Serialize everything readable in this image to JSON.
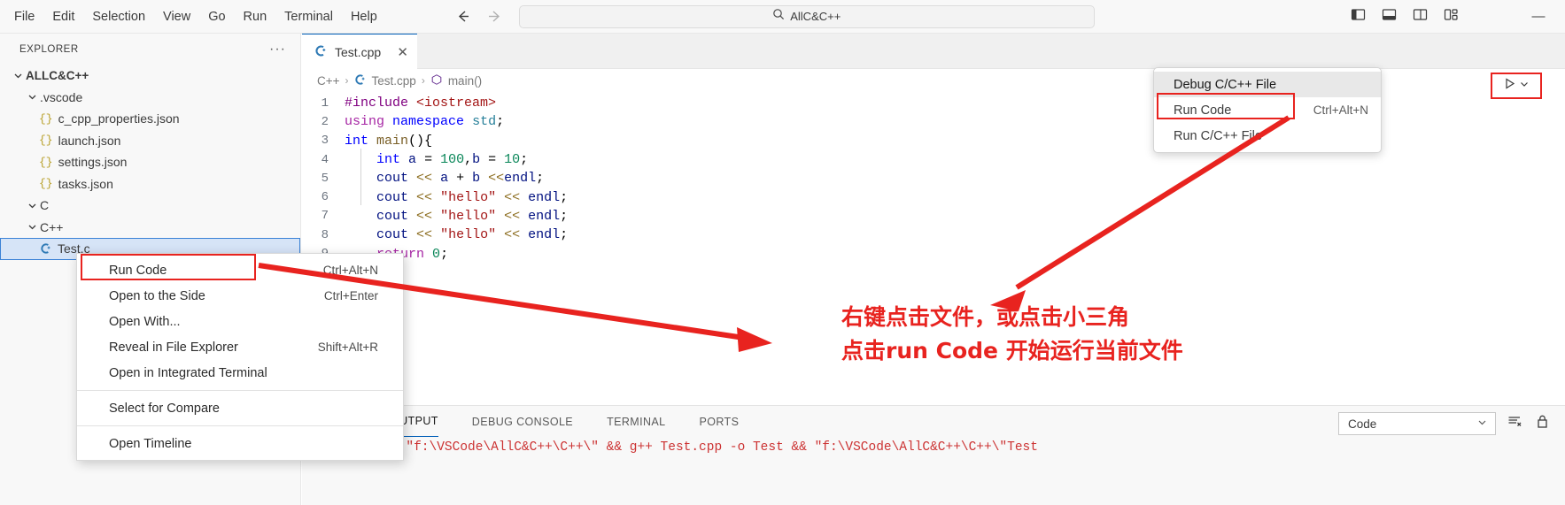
{
  "titlebar": {
    "menus": [
      "File",
      "Edit",
      "Selection",
      "View",
      "Go",
      "Run",
      "Terminal",
      "Help"
    ],
    "back_icon": "arrow-left-icon",
    "forward_icon": "arrow-right-icon",
    "search_value": "AllC&C++",
    "search_icon": "search-icon",
    "layout_icons": [
      "toggle-primary-sidebar-icon",
      "toggle-panel-icon",
      "toggle-secondary-sidebar-icon",
      "customize-layout-icon"
    ],
    "minimize_label": "—"
  },
  "sidebar": {
    "title": "EXPLORER",
    "more_actions": "···",
    "root": "ALLC&C++",
    "items": [
      {
        "label": ".vscode",
        "type": "folder",
        "depth": 1,
        "expanded": true
      },
      {
        "label": "c_cpp_properties.json",
        "type": "json",
        "depth": 2
      },
      {
        "label": "launch.json",
        "type": "json",
        "depth": 2
      },
      {
        "label": "settings.json",
        "type": "json",
        "depth": 2
      },
      {
        "label": "tasks.json",
        "type": "json",
        "depth": 2
      },
      {
        "label": "C",
        "type": "folder",
        "depth": 1,
        "expanded": true
      },
      {
        "label": "C++",
        "type": "folder",
        "depth": 1,
        "expanded": true
      },
      {
        "label": "Test.c",
        "type": "cpp",
        "depth": 2,
        "selected": true
      }
    ]
  },
  "editor": {
    "tab": {
      "label": "Test.cpp",
      "icon": "cpp-file-icon",
      "close_icon": "close-icon"
    },
    "breadcrumb": [
      "C++",
      "Test.cpp",
      "main()"
    ],
    "run_button_icon": "run-play-icon",
    "run_dropdown_icon": "chevron-down-icon",
    "lines": [
      {
        "n": "1",
        "tokens": [
          {
            "t": "#include ",
            "c": "inc"
          },
          {
            "t": "<iostream>",
            "c": "str"
          }
        ]
      },
      {
        "n": "2",
        "tokens": [
          {
            "t": "using",
            "c": "pink"
          },
          {
            "t": " ",
            "c": "plain"
          },
          {
            "t": "namespace",
            "c": "blue"
          },
          {
            "t": " ",
            "c": "plain"
          },
          {
            "t": "std",
            "c": "teal"
          },
          {
            "t": ";",
            "c": "plain"
          }
        ]
      },
      {
        "n": "3",
        "tokens": [
          {
            "t": "int",
            "c": "blue"
          },
          {
            "t": " ",
            "c": "plain"
          },
          {
            "t": "main",
            "c": "fn"
          },
          {
            "t": "(){",
            "c": "plain"
          }
        ]
      },
      {
        "n": "4",
        "tokens": [
          {
            "t": "    ",
            "c": "plain"
          },
          {
            "t": "int",
            "c": "blue"
          },
          {
            "t": " ",
            "c": "plain"
          },
          {
            "t": "a",
            "c": "ident"
          },
          {
            "t": " = ",
            "c": "plain"
          },
          {
            "t": "100",
            "c": "num"
          },
          {
            "t": ",",
            "c": "plain"
          },
          {
            "t": "b",
            "c": "ident"
          },
          {
            "t": " = ",
            "c": "plain"
          },
          {
            "t": "10",
            "c": "num"
          },
          {
            "t": ";",
            "c": "plain"
          }
        ]
      },
      {
        "n": "5",
        "tokens": [
          {
            "t": "    ",
            "c": "plain"
          },
          {
            "t": "cout",
            "c": "ident"
          },
          {
            "t": " ",
            "c": "plain"
          },
          {
            "t": "<<",
            "c": "op"
          },
          {
            "t": " ",
            "c": "plain"
          },
          {
            "t": "a",
            "c": "ident"
          },
          {
            "t": " + ",
            "c": "plain"
          },
          {
            "t": "b",
            "c": "ident"
          },
          {
            "t": " ",
            "c": "plain"
          },
          {
            "t": "<<",
            "c": "op"
          },
          {
            "t": "endl",
            "c": "ident"
          },
          {
            "t": ";",
            "c": "plain"
          }
        ]
      },
      {
        "n": "6",
        "tokens": [
          {
            "t": "    ",
            "c": "plain"
          },
          {
            "t": "cout",
            "c": "ident"
          },
          {
            "t": " ",
            "c": "plain"
          },
          {
            "t": "<<",
            "c": "op"
          },
          {
            "t": " ",
            "c": "plain"
          },
          {
            "t": "\"hello\"",
            "c": "str"
          },
          {
            "t": " ",
            "c": "plain"
          },
          {
            "t": "<<",
            "c": "op"
          },
          {
            "t": " ",
            "c": "plain"
          },
          {
            "t": "endl",
            "c": "ident"
          },
          {
            "t": ";",
            "c": "plain"
          }
        ]
      },
      {
        "n": "7",
        "tokens": [
          {
            "t": "    ",
            "c": "plain"
          },
          {
            "t": "cout",
            "c": "ident"
          },
          {
            "t": " ",
            "c": "plain"
          },
          {
            "t": "<<",
            "c": "op"
          },
          {
            "t": " ",
            "c": "plain"
          },
          {
            "t": "\"hello\"",
            "c": "str"
          },
          {
            "t": " ",
            "c": "plain"
          },
          {
            "t": "<<",
            "c": "op"
          },
          {
            "t": " ",
            "c": "plain"
          },
          {
            "t": "endl",
            "c": "ident"
          },
          {
            "t": ";",
            "c": "plain"
          }
        ]
      },
      {
        "n": "8",
        "tokens": [
          {
            "t": "    ",
            "c": "plain"
          },
          {
            "t": "cout",
            "c": "ident"
          },
          {
            "t": " ",
            "c": "plain"
          },
          {
            "t": "<<",
            "c": "op"
          },
          {
            "t": " ",
            "c": "plain"
          },
          {
            "t": "\"hello\"",
            "c": "str"
          },
          {
            "t": " ",
            "c": "plain"
          },
          {
            "t": "<<",
            "c": "op"
          },
          {
            "t": " ",
            "c": "plain"
          },
          {
            "t": "endl",
            "c": "ident"
          },
          {
            "t": ";",
            "c": "plain"
          }
        ]
      },
      {
        "n": "9",
        "tokens": [
          {
            "t": "    ",
            "c": "plain"
          },
          {
            "t": "return",
            "c": "pink"
          },
          {
            "t": " ",
            "c": "plain"
          },
          {
            "t": "0",
            "c": "num"
          },
          {
            "t": ";",
            "c": "plain"
          }
        ]
      }
    ]
  },
  "run_dropdown": {
    "items": [
      {
        "label": "Debug C/C++ File",
        "shortcut": "",
        "highlighted": true
      },
      {
        "label": "Run Code",
        "shortcut": "Ctrl+Alt+N",
        "highlighted": false
      },
      {
        "label": "Run C/C++ File",
        "shortcut": "",
        "highlighted": false
      }
    ]
  },
  "context_menu": {
    "groups": [
      [
        {
          "label": "Run Code",
          "shortcut": "Ctrl+Alt+N"
        },
        {
          "label": "Open to the Side",
          "shortcut": "Ctrl+Enter"
        },
        {
          "label": "Open With...",
          "shortcut": ""
        },
        {
          "label": "Reveal in File Explorer",
          "shortcut": "Shift+Alt+R"
        },
        {
          "label": "Open in Integrated Terminal",
          "shortcut": ""
        }
      ],
      [
        {
          "label": "Select for Compare",
          "shortcut": ""
        }
      ],
      [
        {
          "label": "Open Timeline",
          "shortcut": ""
        }
      ]
    ]
  },
  "panel": {
    "tabs": [
      "OUTPUT",
      "DEBUG CONSOLE",
      "TERMINAL",
      "PORTS"
    ],
    "active_tab": "OUTPUT",
    "output_text": "d \"f:\\VSCode\\AllC&C++\\C++\\\" && g++ Test.cpp -o Test && \"f:\\VSCode\\AllC&C++\\C++\\\"Test",
    "select_value": "Code",
    "select_chevron": "chevron-down-icon",
    "clear_icon": "clear-output-icon",
    "lock_icon": "lock-icon"
  },
  "annotation": {
    "line1": "右键点击文件，或点击小三角",
    "line2": "点击run Code 开始运行当前文件",
    "color": "#e8231f"
  }
}
